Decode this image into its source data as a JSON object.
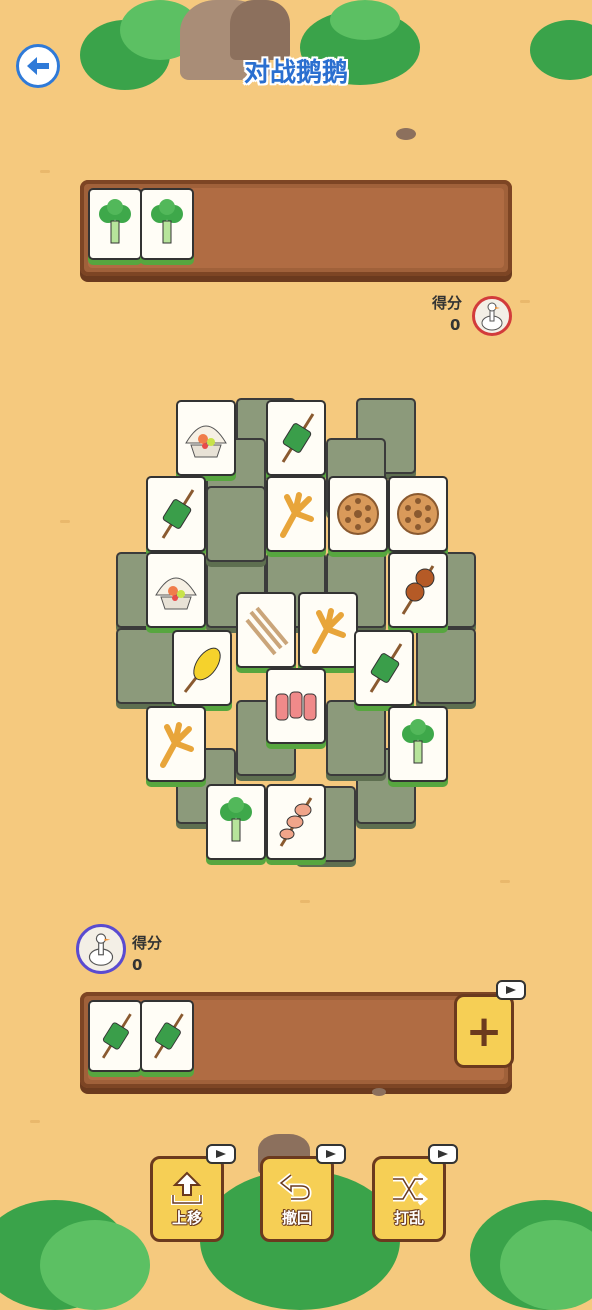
{
  "title": "对战鹅鹅",
  "opponent": {
    "score_label": "得分",
    "score_value": "0",
    "tray_tiles": [
      "broccoli",
      "broccoli"
    ]
  },
  "player": {
    "score_label": "得分",
    "score_value": "0",
    "tray_tiles": [
      "green-skewer",
      "green-skewer"
    ]
  },
  "add_slot_label": "+",
  "tools": [
    {
      "label": "上移",
      "icon": "move-up-icon"
    },
    {
      "label": "撤回",
      "icon": "undo-icon"
    },
    {
      "label": "打乱",
      "icon": "shuffle-icon"
    }
  ],
  "board_tiles": [
    "scallop",
    "green-skewer",
    "green-skewer",
    "chicken-feet",
    "lotus-root",
    "lotus-root",
    "scallop",
    "mushroom-skewer",
    "rope-skewer",
    "chicken-feet",
    "corn",
    "green-skewer",
    "bacon-roll",
    "chicken-feet",
    "broccoli",
    "broccoli",
    "shrimp-skewer"
  ],
  "colors": {
    "accent": "#2a6fd0",
    "tile_base": "#57a63f",
    "tray": "#a0613a",
    "button": "#f6cf55"
  }
}
